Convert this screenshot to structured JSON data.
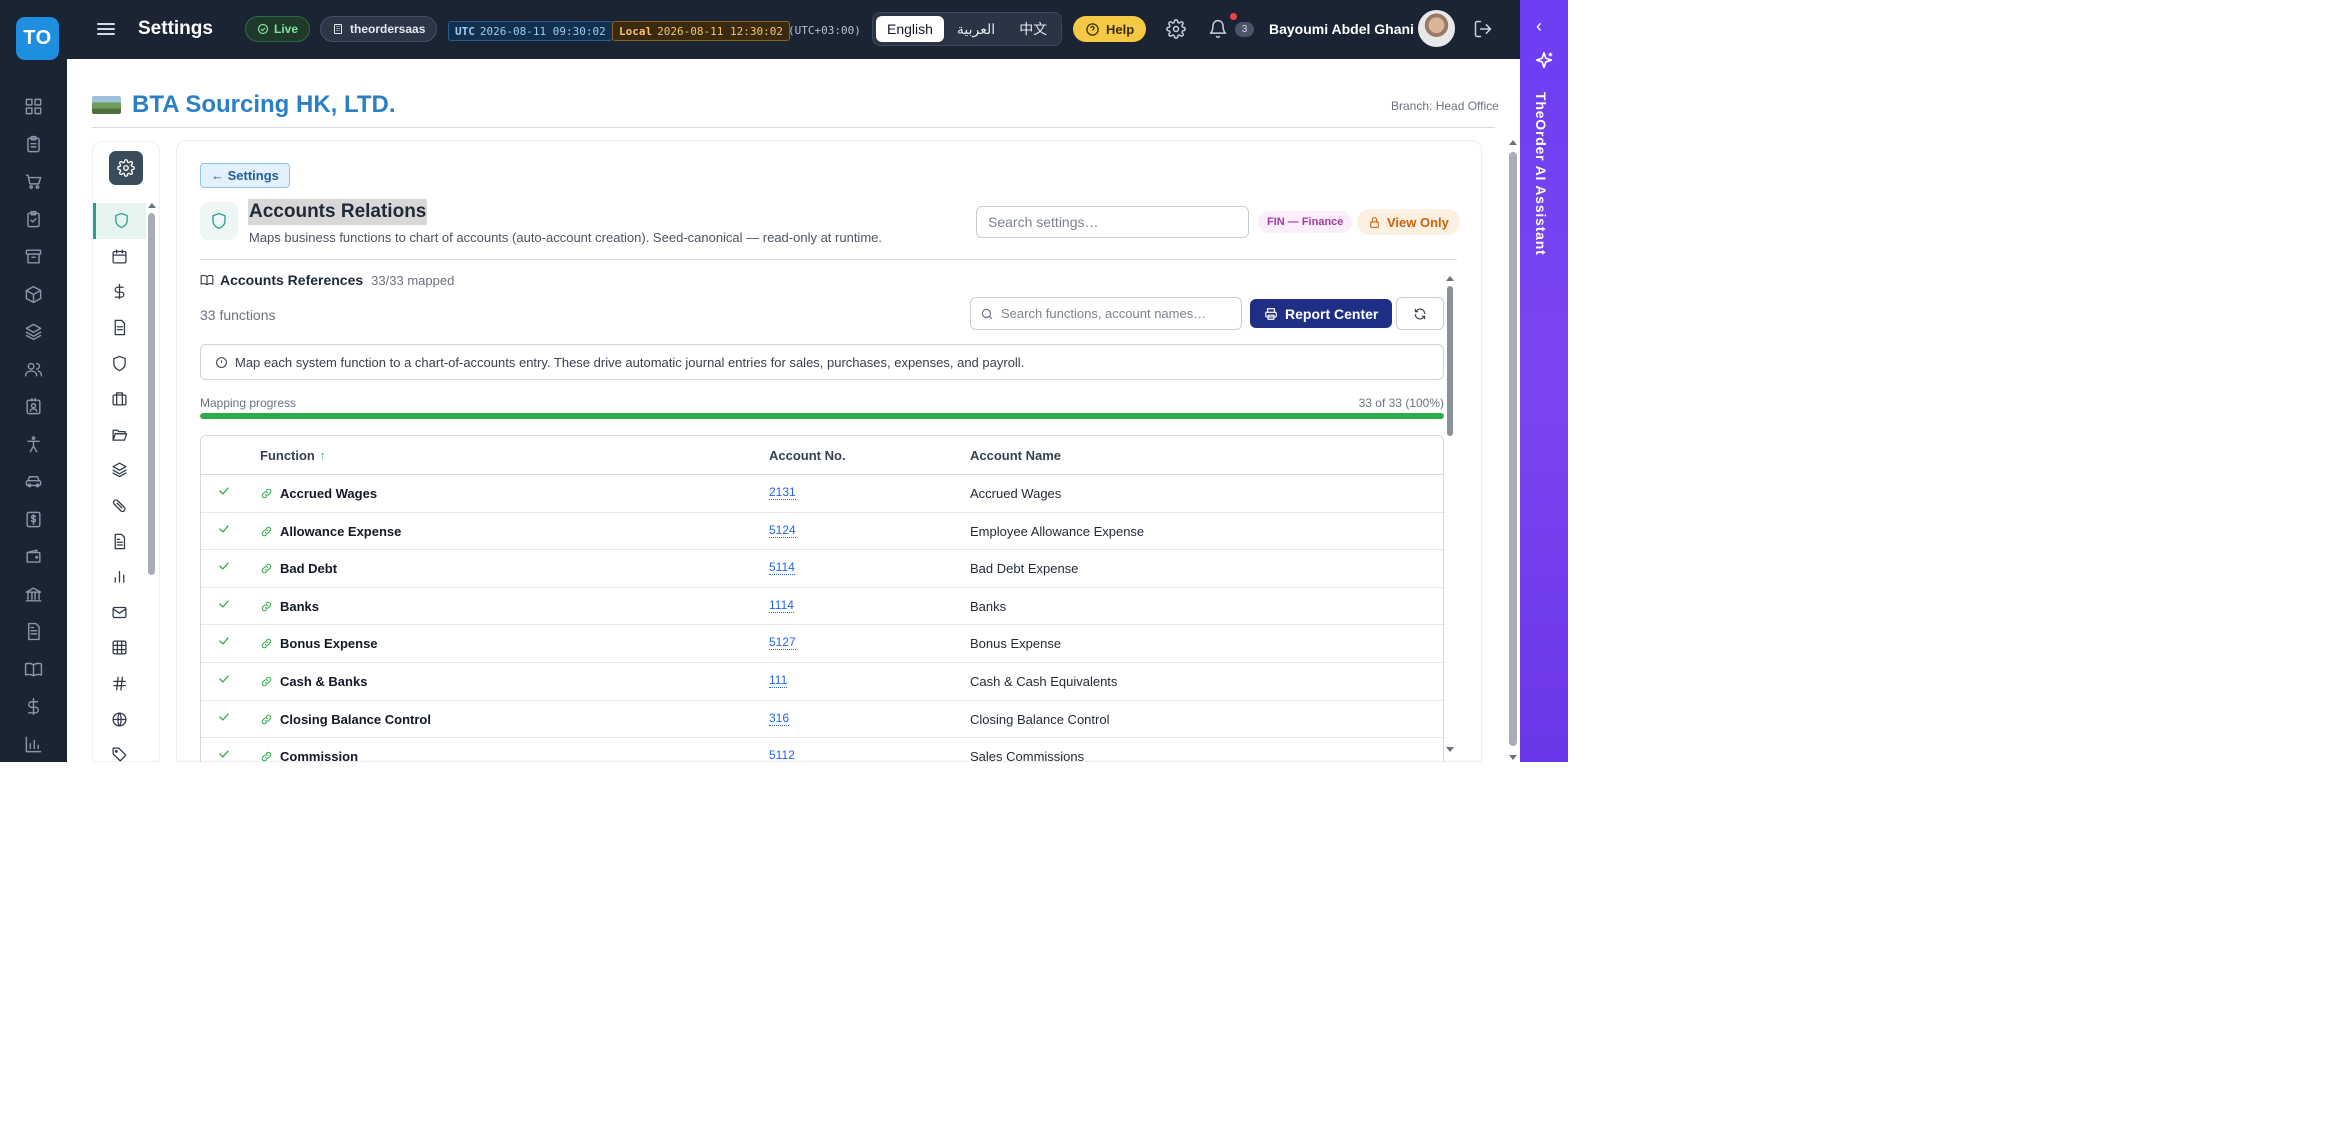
{
  "app": {
    "logo_text": "TO",
    "page_title": "Settings"
  },
  "topbar": {
    "status": "Live",
    "tenant": "theordersaas",
    "utc_tag": "UTC",
    "utc_time": "2026-08-11 09:30:02",
    "local_tag": "Local",
    "local_time": "2026-08-11 12:30:02",
    "tz_offset": "(UTC+03:00)",
    "languages": [
      "English",
      "العربية",
      "中文"
    ],
    "active_language": "English",
    "help_label": "Help",
    "notification_count": "3",
    "user_name": "Bayoumi Abdel Ghani"
  },
  "ai_assistant": {
    "label": "TheOrder AI Assistant"
  },
  "company": {
    "name": "BTA Sourcing HK, LTD.",
    "branch": "Branch: Head Office"
  },
  "rail_icons": [
    "dashboard-icon",
    "clipboard-icon",
    "cart-icon",
    "clipboard-check-icon",
    "archive-icon",
    "box-icon",
    "layers-icon",
    "users-icon",
    "id-card-icon",
    "accessibility-icon",
    "car-icon",
    "dollar-card-icon",
    "wallet-icon",
    "bank-icon",
    "document-icon",
    "book-icon",
    "dollar-icon",
    "chart-icon"
  ],
  "settings_menu": {
    "items": [
      "shield-icon",
      "calendar-icon",
      "dollar-icon",
      "document-icon",
      "shield-outline-icon",
      "briefcase-icon",
      "folder-open-icon",
      "layers-icon",
      "pill-icon",
      "file-text-icon",
      "bar-chart-icon",
      "mail-icon",
      "grid-icon",
      "hash-icon",
      "globe-icon",
      "tag-icon"
    ],
    "active_index": 0
  },
  "page": {
    "back_label": "← Settings",
    "title": "Accounts Relations",
    "subtitle": "Maps business functions to chart of accounts (auto-account creation). Seed-canonical — read-only at runtime.",
    "search_placeholder": "Search settings…",
    "module_tag": "FIN — Finance",
    "access_tag": "View Only"
  },
  "section": {
    "title": "Accounts References",
    "mapped": "33/33 mapped",
    "function_count": "33 functions",
    "search_placeholder": "Search functions, account names…",
    "report_label": "Report Center",
    "info": "Map each system function to a chart-of-accounts entry. These drive automatic journal entries for sales, purchases, expenses, and payroll.",
    "progress_label": "Mapping progress",
    "progress_text": "33 of 33 (100%)",
    "progress_fraction": 1.0
  },
  "table": {
    "columns": {
      "function": "Function",
      "sort_indicator": "↑",
      "account_no": "Account No.",
      "account_name": "Account Name"
    },
    "rows": [
      {
        "function": "Accrued Wages",
        "account_no": "2131",
        "account_name": "Accrued Wages"
      },
      {
        "function": "Allowance Expense",
        "account_no": "5124",
        "account_name": "Employee Allowance Expense"
      },
      {
        "function": "Bad Debt",
        "account_no": "5114",
        "account_name": "Bad Debt Expense"
      },
      {
        "function": "Banks",
        "account_no": "1114",
        "account_name": "Banks"
      },
      {
        "function": "Bonus Expense",
        "account_no": "5127",
        "account_name": "Bonus Expense"
      },
      {
        "function": "Cash & Banks",
        "account_no": "111",
        "account_name": "Cash & Cash Equivalents"
      },
      {
        "function": "Closing Balance Control",
        "account_no": "316",
        "account_name": "Closing Balance Control"
      },
      {
        "function": "Commission",
        "account_no": "5112",
        "account_name": "Sales Commissions"
      }
    ]
  },
  "colors": {
    "accent": "#2b9f8f",
    "brand_blue": "#1e8fe0",
    "navbar": "#1b2433",
    "ai_purple": "#6b3df2",
    "success": "#2eaa4a",
    "report_button": "#1f2f86"
  }
}
